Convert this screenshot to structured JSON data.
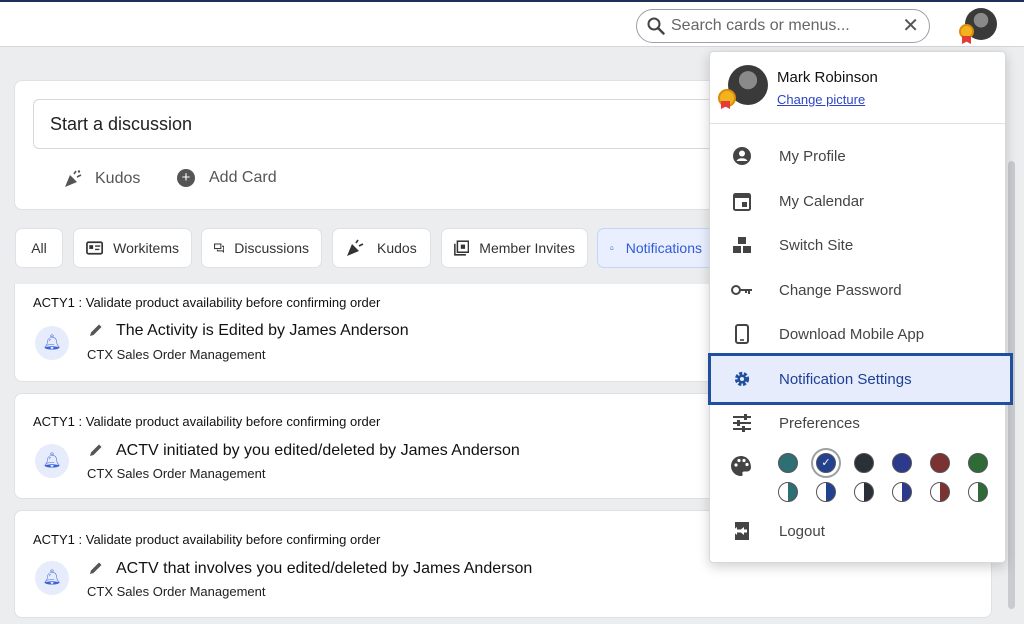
{
  "header": {
    "search_placeholder": "Search cards or menus...",
    "clear_icon": "close-icon",
    "search_icon": "search-icon"
  },
  "composer": {
    "placeholder": "Start a discussion",
    "actions": [
      {
        "label": "Kudos",
        "icon": "party-popper-icon"
      },
      {
        "label": "Add Card",
        "icon": "plus-circle-icon"
      }
    ]
  },
  "filters": [
    {
      "label": "All"
    },
    {
      "label": "Workitems",
      "icon": "id-card-icon"
    },
    {
      "label": "Discussions",
      "icon": "chat-bubbles-icon"
    },
    {
      "label": "Kudos",
      "icon": "party-popper-icon"
    },
    {
      "label": "Member Invites",
      "icon": "invite-icon"
    },
    {
      "label": "Notifications",
      "icon": "bell-icon",
      "active": true
    }
  ],
  "notifications": [
    {
      "code": "ACTY1 : Validate product availability before confirming order",
      "title": "The Activity is Edited by James Anderson",
      "subtitle": "CTX Sales Order Management"
    },
    {
      "code": "ACTY1 : Validate product availability before confirming order",
      "title": "ACTV initiated by you edited/deleted by James Anderson",
      "subtitle": "CTX Sales Order Management"
    },
    {
      "code": "ACTY1 : Validate product availability before confirming order",
      "title": "ACTV that involves you edited/deleted by James Anderson",
      "subtitle": "CTX Sales Order Management"
    }
  ],
  "user_menu": {
    "name": "Mark Robinson",
    "change_picture": "Change picture",
    "items": [
      {
        "label": "My Profile",
        "icon": "account-circle-icon"
      },
      {
        "label": "My Calendar",
        "icon": "calendar-icon"
      },
      {
        "label": "Switch Site",
        "icon": "switch-site-icon"
      },
      {
        "label": "Change Password",
        "icon": "key-icon"
      },
      {
        "label": "Download Mobile App",
        "icon": "mobile-phone-icon"
      },
      {
        "label": "Notification Settings",
        "icon": "gear-icon",
        "highlighted": true
      },
      {
        "label": "Preferences",
        "icon": "sliders-icon"
      }
    ],
    "theme_icon": "palette-icon",
    "theme_colors": [
      {
        "color": "#2e6f73",
        "selected": false
      },
      {
        "color": "#22418f",
        "selected": true
      },
      {
        "color": "#2b2f36",
        "selected": false
      },
      {
        "color": "#2b3a8c",
        "selected": false
      },
      {
        "color": "#7a3232",
        "selected": false
      },
      {
        "color": "#2f6b36",
        "selected": false
      }
    ],
    "logout": {
      "label": "Logout",
      "icon": "logout-icon"
    }
  }
}
